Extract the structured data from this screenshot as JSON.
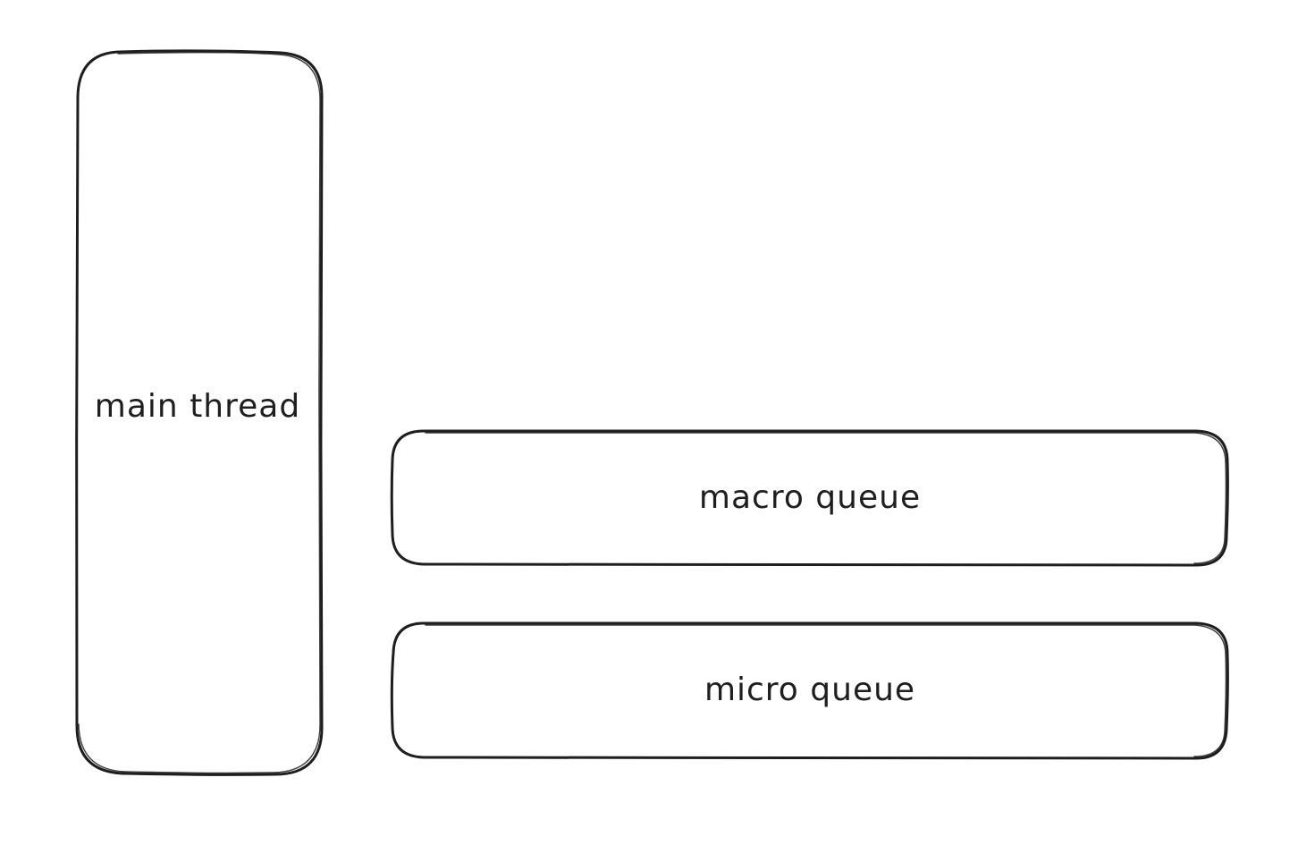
{
  "diagram": {
    "nodes": [
      {
        "id": "main",
        "label": "main thread"
      },
      {
        "id": "macro",
        "label": "macro queue"
      },
      {
        "id": "micro",
        "label": "micro queue"
      }
    ],
    "colors": {
      "stroke": "#1e1e1e",
      "background": "#ffffff"
    }
  }
}
